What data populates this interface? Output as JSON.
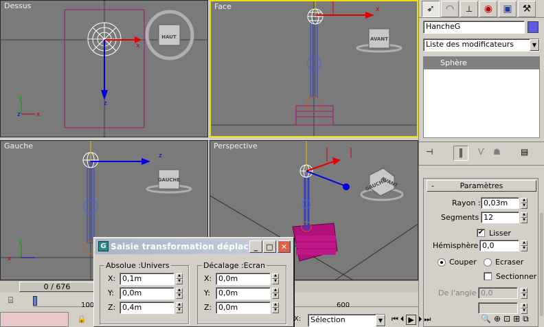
{
  "viewports": {
    "top": {
      "label": "Dessus",
      "cube_label": "HAUT"
    },
    "front": {
      "label": "Face",
      "cube_label": "AVANT"
    },
    "left": {
      "label": "Gauche",
      "cube_label": "GAUCHE"
    },
    "perspective": {
      "label": "Perspective",
      "cube_label_a": "GAUCHE",
      "cube_label_b": "AVANT"
    }
  },
  "command_panel": {
    "object_name": "HancheG",
    "object_color": "#5a5ae0",
    "modifier_list": "Liste des modificateurs",
    "stack_item": "Sphère",
    "rollout_title": "Paramètres",
    "radius_label": "Rayon :",
    "radius_value": "0,03m",
    "segments_label": "Segments :",
    "segments_value": "12",
    "smooth_label": "Lisser",
    "smooth_checked": true,
    "hemisphere_label": "Hémisphère :",
    "hemisphere_value": "0,0",
    "squash_label": "Couper",
    "stretch_label": "Ecraser",
    "squash_selected": "Couper",
    "slice_label": "Sectionner",
    "slice_checked": false,
    "slice_from_label": "De l'angle :",
    "slice_from_value": "0,0"
  },
  "timeline": {
    "frame_counter": "0 / 676",
    "ticks": [
      "100",
      "600"
    ]
  },
  "status": {
    "coord_x_label": "X:",
    "selection_dropdown": "Sélection"
  },
  "dialog": {
    "title": "Saisie transformation déplac...",
    "left_group": "Absolue :Univers",
    "right_group": "Décalage :Ecran",
    "x_label": "X:",
    "y_label": "Y:",
    "z_label": "Z:",
    "abs_x": "0,1m",
    "abs_y": "0,0m",
    "abs_z": "0,4m",
    "off_x": "0,0m",
    "off_y": "0,0m",
    "off_z": "0,0m"
  },
  "colors": {
    "viewport_bg": "#7a7a7a",
    "active_border": "#f0e000",
    "gizmo_x": "#e00000",
    "gizmo_y": "#0000e0",
    "bone_blue": "#3040c0",
    "base_magenta": "#b0107a"
  },
  "icons": [
    "arrow-cursor-icon",
    "modify-arc-icon",
    "hierarchy-icon",
    "motion-icon",
    "display-icon",
    "utilities-hammer-icon"
  ]
}
